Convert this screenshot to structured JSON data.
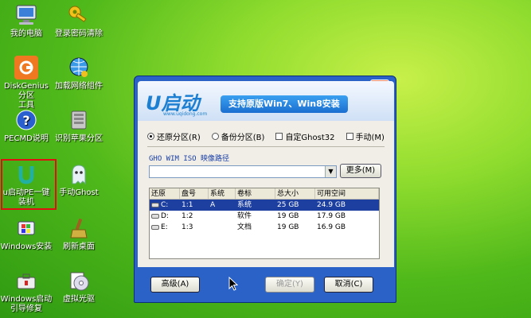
{
  "desktop": {
    "icons": [
      {
        "label": "我的电脑",
        "icon": "computer-icon"
      },
      {
        "label": "登录密码清除",
        "icon": "key-icon"
      },
      {
        "label": "DiskGenius分区\n工具",
        "icon": "diskgenius-icon"
      },
      {
        "label": "加载网络组件",
        "icon": "network-globe-icon"
      },
      {
        "label": "PECMD说明",
        "icon": "help-icon"
      },
      {
        "label": "识别苹果分区",
        "icon": "hard-drive-icon"
      },
      {
        "label": "u启动PE一键\n装机",
        "icon": "u-install-icon"
      },
      {
        "label": "手动Ghost",
        "icon": "ghost-icon"
      },
      {
        "label": "Windows安装",
        "icon": "windows-install-icon"
      },
      {
        "label": "刷新桌面",
        "icon": "broom-icon"
      },
      {
        "label": "Windows启动\n引导修复",
        "icon": "toolbox-icon"
      },
      {
        "label": "虚拟光驱",
        "icon": "virtual-cd-icon"
      }
    ]
  },
  "window": {
    "close_label": "X",
    "logo_text": "U启动",
    "logo_sub": "www.uqidong.com",
    "slogan": "支持原版Win7、Win8安装",
    "options": [
      {
        "label": "还原分区(R)",
        "type": "radio",
        "checked": true
      },
      {
        "label": "备份分区(B)",
        "type": "radio",
        "checked": false
      },
      {
        "label": "自定Ghost32",
        "type": "checkbox",
        "checked": false
      },
      {
        "label": "手动(M)",
        "type": "checkbox",
        "checked": false
      }
    ],
    "path_label": "GHO WIM ISO 映像路径",
    "path_value": "",
    "more_button": "更多(M)",
    "table": {
      "columns": [
        "还原",
        "盘号",
        "系统",
        "卷标",
        "总大小",
        "可用空间"
      ],
      "rows": [
        [
          "C:",
          "1:1",
          "A",
          "系统",
          "25 GB",
          "24.9 GB"
        ],
        [
          "D:",
          "1:2",
          "",
          "软件",
          "19 GB",
          "17.9 GB"
        ],
        [
          "E:",
          "1:3",
          "",
          "文档",
          "19 GB",
          "16.9 GB"
        ]
      ],
      "selected_row": 0
    },
    "advanced_button": "高级(A)",
    "confirm_button": "确定(Y)",
    "cancel_button": "取消(C)"
  }
}
